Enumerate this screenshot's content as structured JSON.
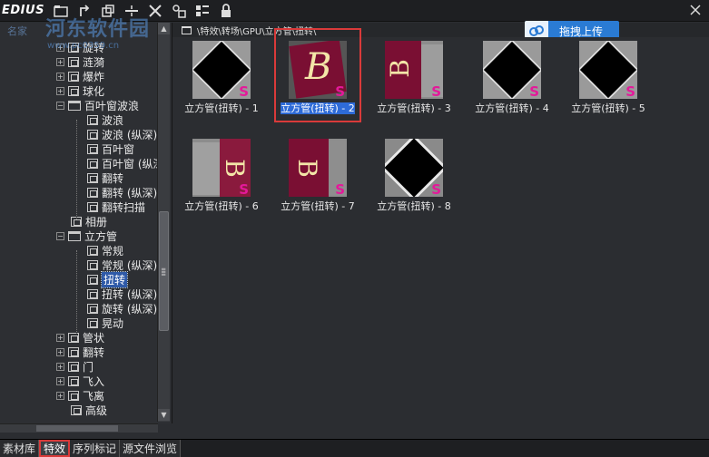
{
  "app": {
    "logo": "EDIUS",
    "watermark_title": "河东软件园",
    "watermark_url": "www.pc0359.cn",
    "watermark_left": "名家"
  },
  "toolbar": {
    "icons": [
      "folder-icon",
      "up-icon",
      "copy-icon",
      "line-icon",
      "cut-icon",
      "search-replace-icon",
      "view-icon",
      "lock-icon"
    ]
  },
  "path": {
    "text": "\\特效\\转场\\GPU\\立方管\\扭转\\"
  },
  "upload": {
    "label": "拖拽上传"
  },
  "tree": {
    "items": [
      {
        "label": "旋转",
        "type": "node",
        "level": 1
      },
      {
        "label": "涟漪",
        "type": "node",
        "level": 1
      },
      {
        "label": "爆炸",
        "type": "node",
        "level": 1
      },
      {
        "label": "球化",
        "type": "node",
        "level": 1
      },
      {
        "label": "百叶窗波浪",
        "type": "folder",
        "level": 1
      },
      {
        "label": "波浪",
        "type": "leaf",
        "level": 2
      },
      {
        "label": "波浪 (纵深)",
        "type": "leaf",
        "level": 2
      },
      {
        "label": "百叶窗",
        "type": "leaf",
        "level": 2
      },
      {
        "label": "百叶窗 (纵深)",
        "type": "leaf",
        "level": 2
      },
      {
        "label": "翻转",
        "type": "leaf",
        "level": 2
      },
      {
        "label": "翻转 (纵深)",
        "type": "leaf",
        "level": 2
      },
      {
        "label": "翻转扫描",
        "type": "leaf",
        "level": 2
      },
      {
        "label": "相册",
        "type": "leaf1",
        "level": 1
      },
      {
        "label": "立方管",
        "type": "folder",
        "level": 1
      },
      {
        "label": "常规",
        "type": "leaf",
        "level": 2
      },
      {
        "label": "常规 (纵深)",
        "type": "leaf",
        "level": 2
      },
      {
        "label": "扭转",
        "type": "leaf",
        "level": 2,
        "selected": true
      },
      {
        "label": "扭转 (纵深)",
        "type": "leaf",
        "level": 2
      },
      {
        "label": "旋转 (纵深)",
        "type": "leaf",
        "level": 2
      },
      {
        "label": "晃动",
        "type": "leaf",
        "level": 2
      },
      {
        "label": "管状",
        "type": "node",
        "level": 1
      },
      {
        "label": "翻转",
        "type": "node",
        "level": 1
      },
      {
        "label": "门",
        "type": "node",
        "level": 1
      },
      {
        "label": "飞入",
        "type": "node",
        "level": 1
      },
      {
        "label": "飞离",
        "type": "node",
        "level": 1
      },
      {
        "label": "高级",
        "type": "leaf1",
        "level": 1
      }
    ]
  },
  "thumbnails": [
    {
      "label": "立方管(扭转) - 1",
      "style": "dark"
    },
    {
      "label": "立方管(扭转) - 2",
      "style": "bface",
      "selected": true
    },
    {
      "label": "立方管(扭转) - 3",
      "style": "bside"
    },
    {
      "label": "立方管(扭转) - 4",
      "style": "dark"
    },
    {
      "label": "立方管(扭转) - 5",
      "style": "dark"
    },
    {
      "label": "立方管(扭转) - 6",
      "style": "bleft"
    },
    {
      "label": "立方管(扭转) - 7",
      "style": "bcenter"
    },
    {
      "label": "立方管(扭转) - 8",
      "style": "darkdiag"
    }
  ],
  "bottom_tabs": [
    {
      "label": "素材库"
    },
    {
      "label": "特效",
      "active": true
    },
    {
      "label": "序列标记"
    },
    {
      "label": "源文件浏览"
    }
  ],
  "thumb_letters": {
    "b": "B",
    "s": "S"
  },
  "colors": {
    "accent_red": "#d93a3a",
    "selection_blue": "#2e6bd8",
    "magenta": "#e4199a",
    "maroon": "#7a0f33"
  }
}
